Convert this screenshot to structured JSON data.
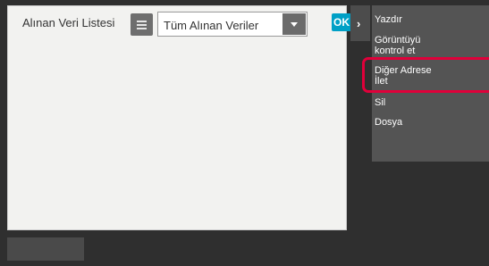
{
  "header": {
    "list_title": "Alınan Veri Listesi",
    "filter_value": "Tüm Alınan Veriler",
    "ok_label": "OK"
  },
  "side_menu": {
    "items": [
      {
        "label": "Yazdır"
      },
      {
        "label": "Görüntüyü\nkontrol et"
      },
      {
        "label": "Diğer Adrese\nİlet"
      },
      {
        "label": "Sil"
      },
      {
        "label": "Dosya"
      }
    ]
  },
  "icons": {
    "list_icon": "list-icon",
    "dropdown_icon": "chevron-down-icon",
    "side_toggle": "chevron-right-icon"
  },
  "colors": {
    "accent_ok": "#00a0c6",
    "highlight": "#e0003a",
    "menu_background": "#545454"
  }
}
